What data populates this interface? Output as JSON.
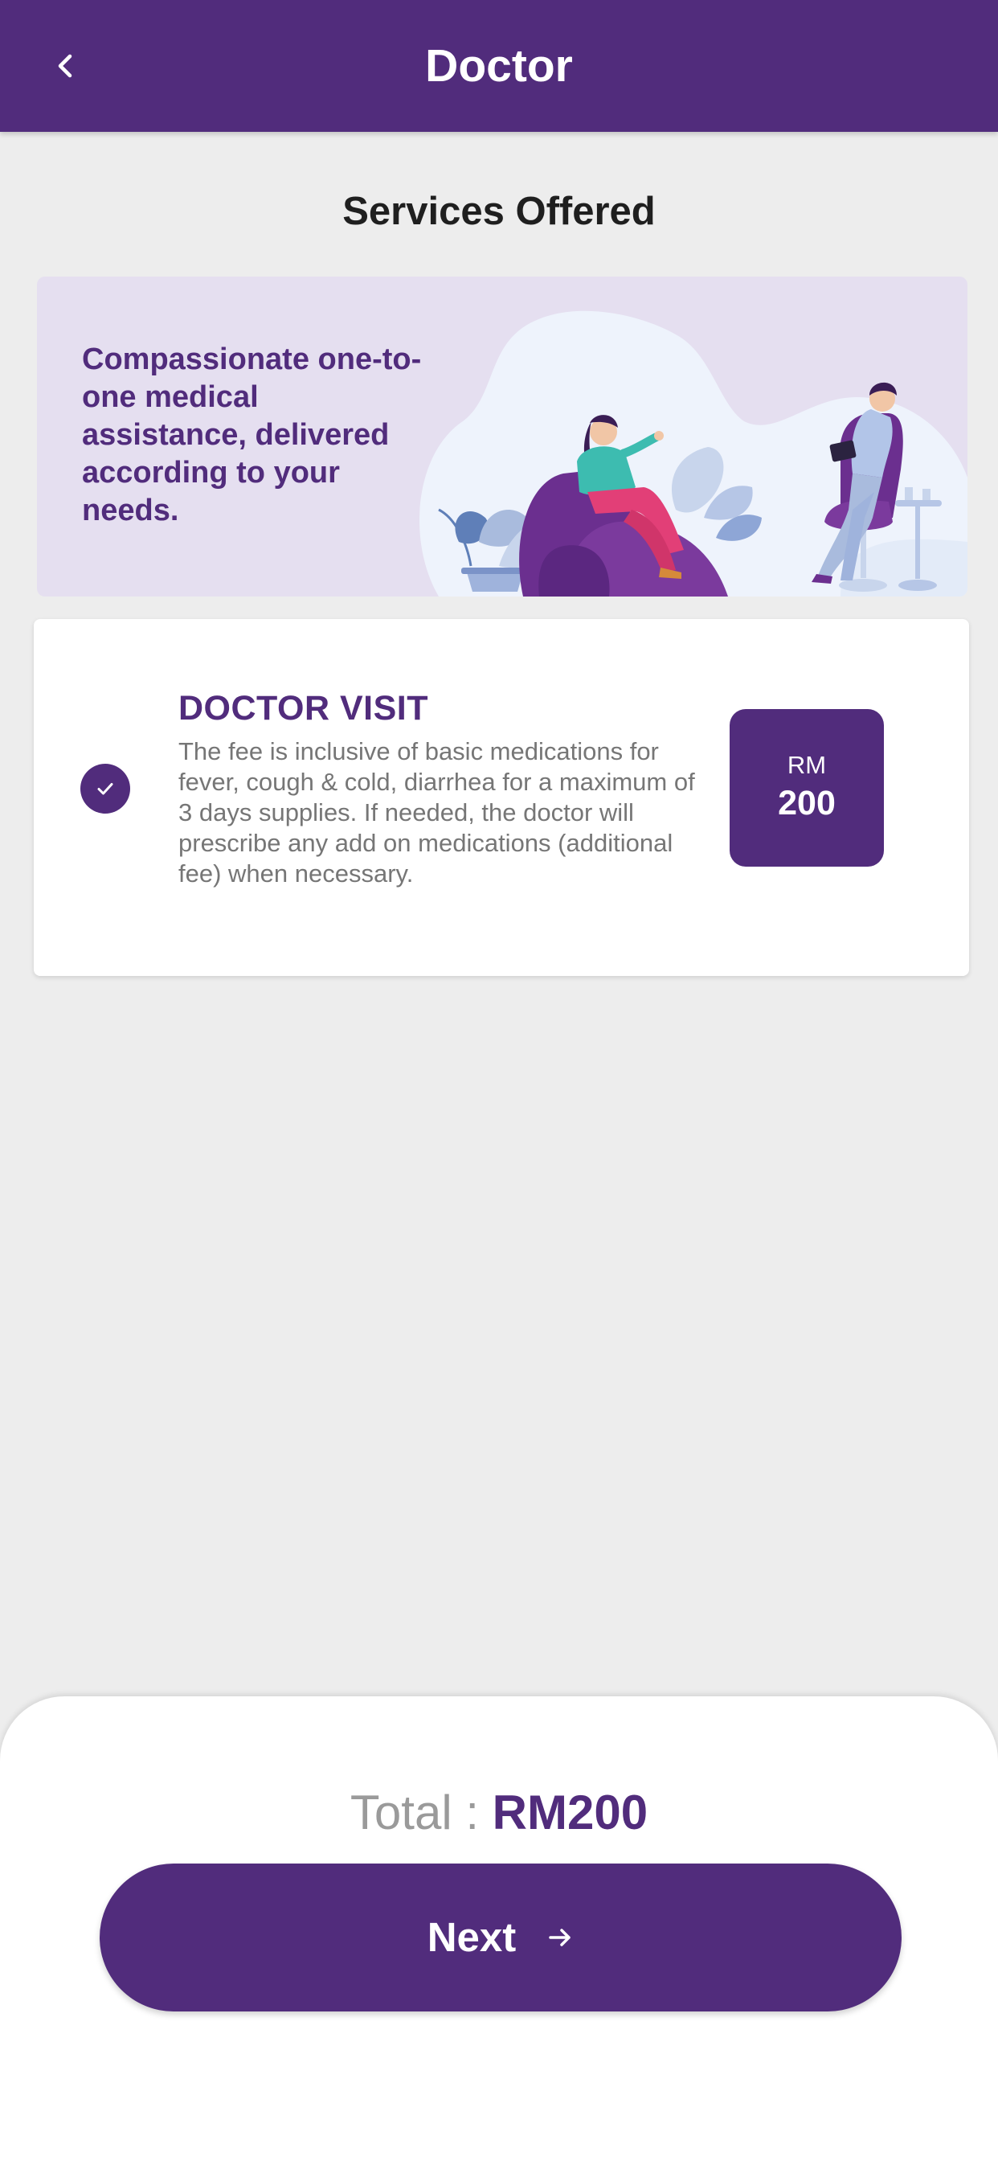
{
  "header": {
    "title": "Doctor",
    "back_icon": "chevron-left-icon"
  },
  "section": {
    "title": "Services Offered"
  },
  "banner": {
    "text": "Compassionate one-to-one medical assistance, delivered according to your needs.",
    "illustration": "doctor-patient-consultation-illustration"
  },
  "service": {
    "selected": true,
    "check_icon": "check-icon",
    "name": "DOCTOR VISIT",
    "description": "The fee is inclusive of basic medications for fever, cough & cold, diarrhea for a maximum of 3 days supplies. If needed, the doctor will prescribe any add on medications (additional fee) when necessary.",
    "price_currency": "RM",
    "price_amount": "200"
  },
  "footer": {
    "total_label": "Total : ",
    "total_value": "RM200",
    "next_label": "Next",
    "next_icon": "arrow-right-icon"
  },
  "colors": {
    "primary": "#512c7c",
    "background": "#ededed",
    "banner_bg": "#e5dff0",
    "description_text": "#767676",
    "total_label": "#9a9a9a"
  }
}
